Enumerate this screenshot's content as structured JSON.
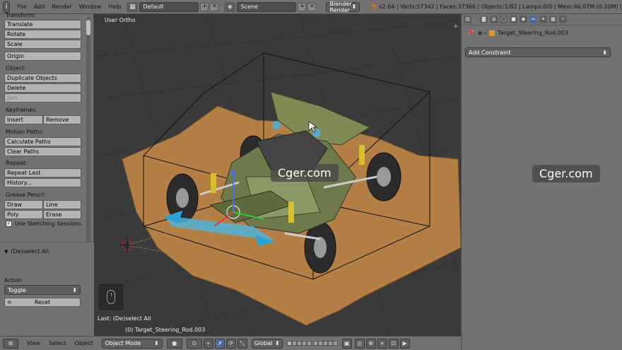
{
  "topbar": {
    "editor_icon": "i",
    "menus": [
      "File",
      "Add",
      "Render",
      "Window",
      "Help"
    ],
    "screen_layout": "Default",
    "scene": "Scene",
    "render_engine": "Blender Render",
    "stats": "v2.64 | Verts:57342 | Faces:37366 | Objects:1/82 | Lamps:0/0 | Mem:46.07M (0.10M) |"
  },
  "toolshelf": {
    "transform_title": "Transform:",
    "translate": "Translate",
    "rotate": "Rotate",
    "scale": "Scale",
    "origin": "Origin",
    "object_title": "Object:",
    "duplicate": "Duplicate Objects",
    "delete": "Delete",
    "join": "Join",
    "keyframes_title": "Keyframes:",
    "insert": "Insert",
    "remove": "Remove",
    "motion_title": "Motion Paths:",
    "calc_paths": "Calculate Paths",
    "clear_paths": "Clear Paths",
    "repeat_title": "Repeat:",
    "repeat_last": "Repeat Last",
    "history": "History...",
    "grease_title": "Grease Pencil:",
    "draw": "Draw",
    "line": "Line",
    "poly": "Poly",
    "erase": "Erase",
    "sketching": "Use Sketching Sessions"
  },
  "operator": {
    "title": "(De)select All",
    "action_label": "Action",
    "action_value": "Toggle",
    "reset": "Reset"
  },
  "viewport": {
    "view_label": "User Ortho",
    "last_op": "Last: (De)select All",
    "object_name": "(0) Target_Steering_Rod.003",
    "watermark": "Cger.com"
  },
  "props": {
    "object_path": "Target_Steering_Rod.003",
    "add_constraint": "Add Constraint"
  },
  "watermark_right": "Cger.com",
  "bottombar": {
    "menus": [
      "View",
      "Select",
      "Object"
    ],
    "mode": "Object Mode",
    "orientation": "Global"
  }
}
